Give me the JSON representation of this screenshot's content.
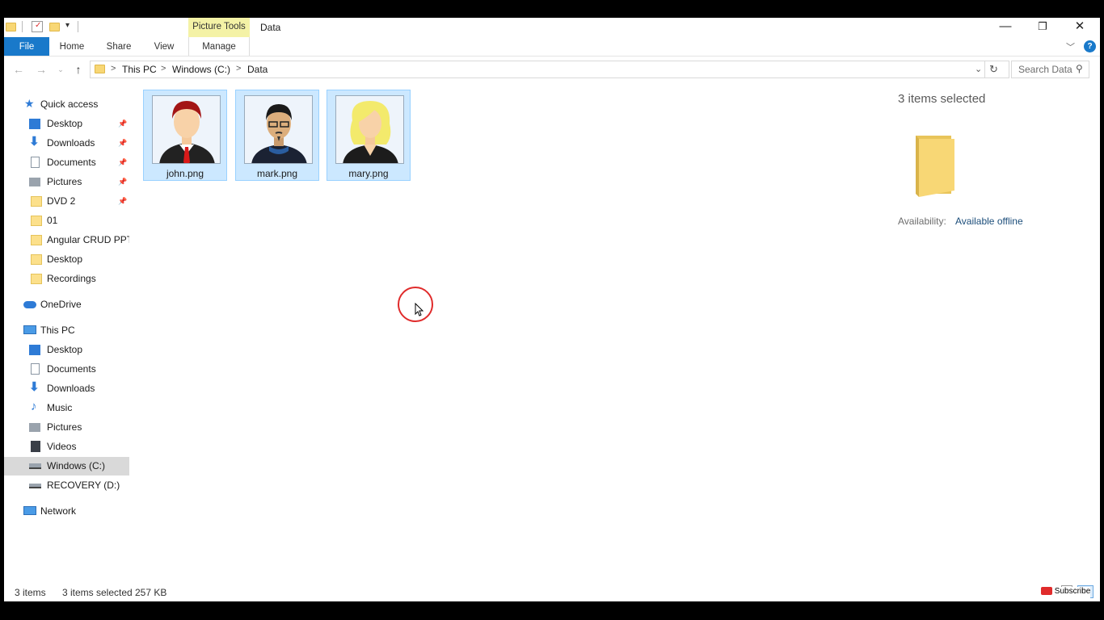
{
  "window": {
    "contextual_group": "Picture Tools",
    "title": "Data",
    "minimize": "—",
    "restore": "❐",
    "close": "✕"
  },
  "ribbon": {
    "tabs": [
      "File",
      "Home",
      "Share",
      "View",
      "Manage"
    ],
    "collapse_icon": "﹀",
    "help_icon": "?"
  },
  "address": {
    "crumbs": [
      "This PC",
      "Windows (C:)",
      "Data"
    ],
    "separator": ">",
    "search_placeholder": "Search Data"
  },
  "sidebar": {
    "quick_access": "Quick access",
    "quick_items": [
      "Desktop",
      "Downloads",
      "Documents",
      "Pictures",
      "DVD 2",
      "01",
      "Angular CRUD PPTs",
      "Desktop",
      "Recordings"
    ],
    "onedrive": "OneDrive",
    "this_pc": "This PC",
    "pc_items": [
      "Desktop",
      "Documents",
      "Downloads",
      "Music",
      "Pictures",
      "Videos",
      "Windows (C:)",
      "RECOVERY (D:)"
    ],
    "network": "Network"
  },
  "files": [
    {
      "name": "john.png"
    },
    {
      "name": "mark.png"
    },
    {
      "name": "mary.png"
    }
  ],
  "details": {
    "selection": "3 items selected",
    "availability_label": "Availability:",
    "availability_value": "Available offline"
  },
  "status": {
    "items": "3 items",
    "selected": "3 items selected",
    "size": "257 KB"
  },
  "overlay": {
    "subscribe": "Subscribe"
  },
  "colors": {
    "file_tab": "#1979ca",
    "picture_tools": "#f4f2a6",
    "selection_fill": "#cce8ff",
    "selection_border": "#99d1ff"
  }
}
